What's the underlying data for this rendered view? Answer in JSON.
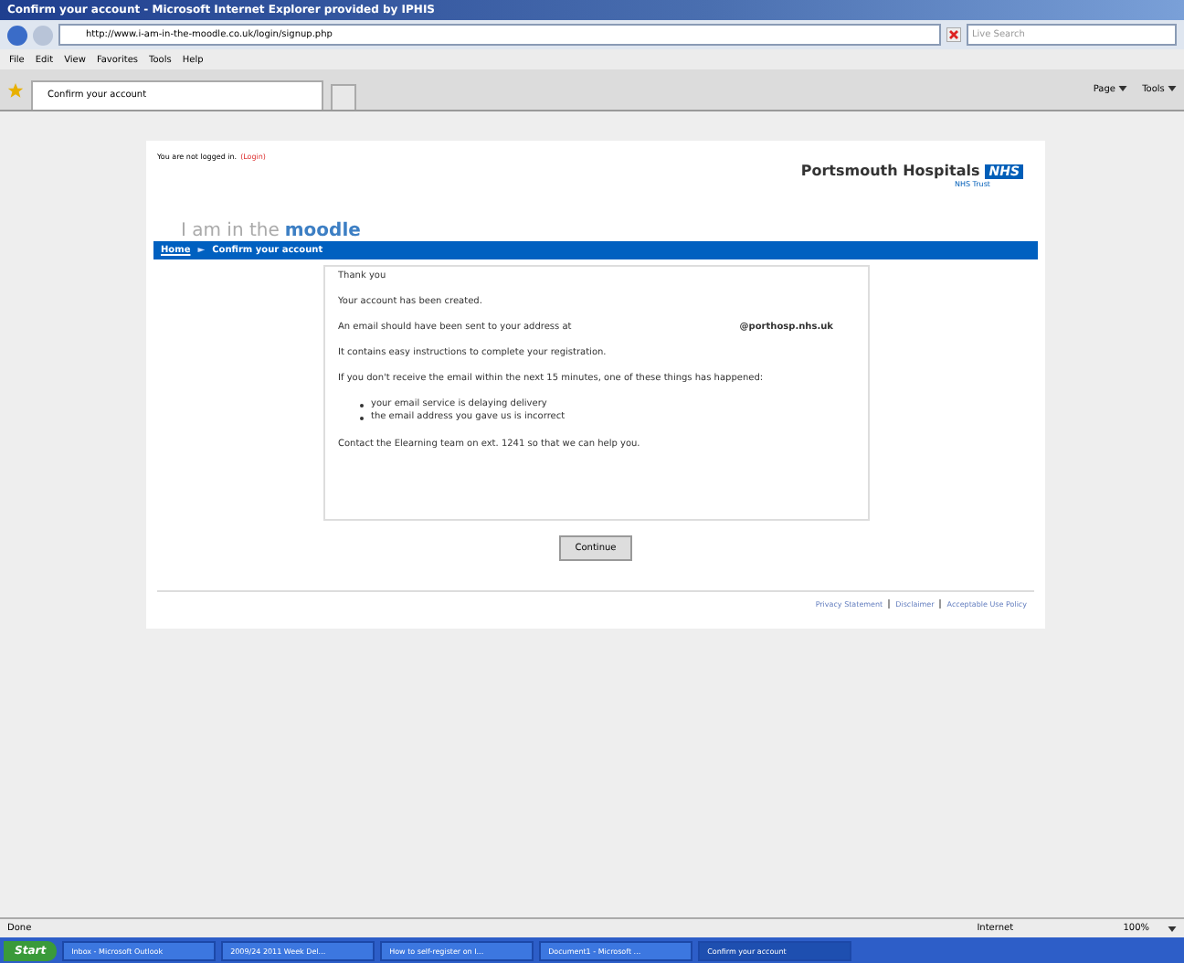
{
  "window": {
    "title": "Confirm your account - Microsoft Internet Explorer provided by IPHIS"
  },
  "address_bar": {
    "url": "http://www.i-am-in-the-moodle.co.uk/login/signup.php",
    "search_placeholder": "Live Search"
  },
  "menu": [
    "File",
    "Edit",
    "View",
    "Favorites",
    "Tools",
    "Help"
  ],
  "tab": {
    "label": "Confirm your account"
  },
  "command_bar": [
    "Page",
    "Tools"
  ],
  "page": {
    "login_status": "You are not logged in.",
    "login_link": "(Login)",
    "org_name": "Portsmouth Hospitals",
    "org_badge": "NHS",
    "org_sub": "NHS Trust",
    "site_logo_light": "I am in the",
    "site_logo_bold": "moodle",
    "breadcrumb": [
      {
        "label": "Home",
        "kind": "link"
      },
      {
        "label": "►",
        "kind": "separator"
      },
      {
        "label": "Confirm your account",
        "kind": "current"
      }
    ],
    "messages": [
      {
        "kind": "text",
        "text": "Thank you"
      },
      {
        "kind": "text",
        "text": "Your account has been created."
      },
      {
        "kind": "email",
        "text": "An email should have been sent to your address at",
        "email": "@porthosp.nhs.uk"
      },
      {
        "kind": "text",
        "text": "It contains easy instructions to complete your registration."
      },
      {
        "kind": "text",
        "text": "If you don't receive the email within the next 15 minutes, one of these things has happened:"
      },
      {
        "kind": "list",
        "items": [
          "your email service is delaying delivery",
          "the email address you gave us is incorrect"
        ]
      },
      {
        "kind": "text",
        "text": "Contact the Elearning team on ext. 1241 so that we can help you."
      }
    ],
    "button": "Continue",
    "footer_links": [
      "Privacy Statement",
      "Disclaimer",
      "Acceptable Use Policy"
    ]
  },
  "status_bar": {
    "text": "Done",
    "zone": "Internet",
    "zoom": "100%"
  },
  "taskbar": {
    "start": "Start",
    "items": [
      {
        "label": "Inbox - Microsoft Outlook",
        "selected": false
      },
      {
        "label": "2009/24 2011 Week Del...",
        "selected": false
      },
      {
        "label": "How to self-register on I...",
        "selected": false
      },
      {
        "label": "Document1 - Microsoft ...",
        "selected": false
      },
      {
        "label": "Confirm your account",
        "selected": true
      }
    ]
  }
}
